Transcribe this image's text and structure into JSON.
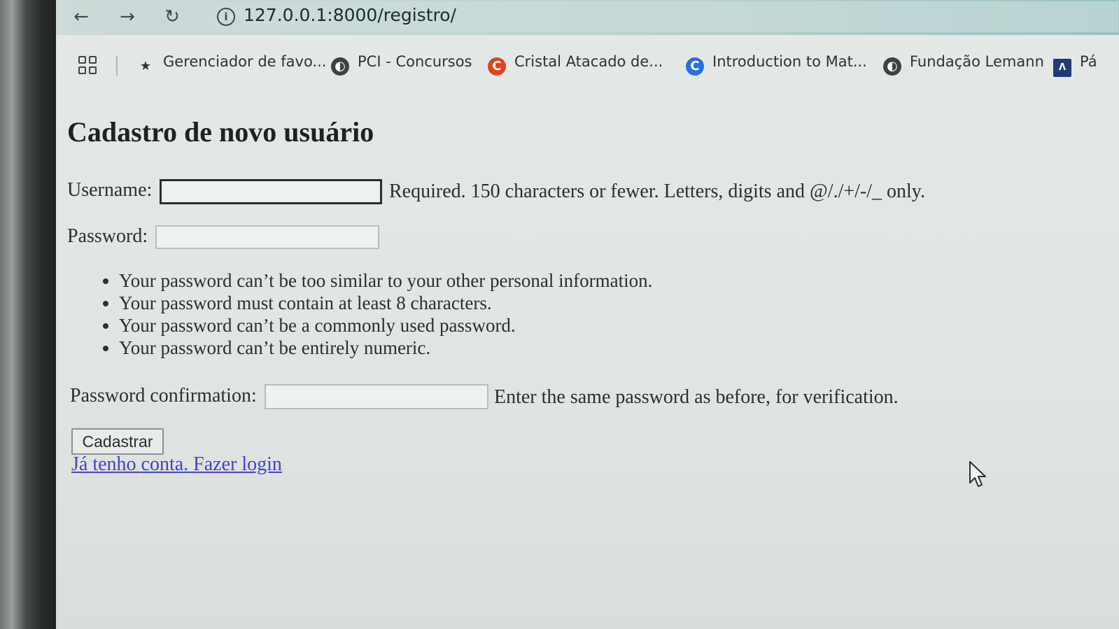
{
  "browser": {
    "url": "127.0.0.1:8000/registro/",
    "bookmarks": [
      {
        "label": "Gerenciador de favo...",
        "icon": "star-icon"
      },
      {
        "label": "PCI - Concursos",
        "icon": "globe-icon"
      },
      {
        "label": "Cristal Atacado de...",
        "icon": "c-logo-icon",
        "color": "#e0441b"
      },
      {
        "label": "Introduction to Mat...",
        "icon": "c-circle-icon",
        "color": "#2a6fdb"
      },
      {
        "label": "Fundação Lemann",
        "icon": "globe-icon"
      },
      {
        "label": "Pá",
        "icon": "a-square-icon",
        "color": "#203a78"
      }
    ]
  },
  "page": {
    "title": "Cadastro de novo usuário",
    "username_label": "Username:",
    "username_value": "",
    "username_help": "Required. 150 characters or fewer. Letters, digits and @/./+/-/_ only.",
    "password_label": "Password:",
    "password_value": "",
    "password_rules": [
      "Your password can’t be too similar to your other personal information.",
      "Your password must contain at least 8 characters.",
      "Your password can’t be a commonly used password.",
      "Your password can’t be entirely numeric."
    ],
    "confirm_label": "Password confirmation:",
    "confirm_value": "",
    "confirm_help": "Enter the same password as before, for verification.",
    "submit_label": "Cadastrar",
    "login_link": "Já tenho conta. Fazer login"
  }
}
